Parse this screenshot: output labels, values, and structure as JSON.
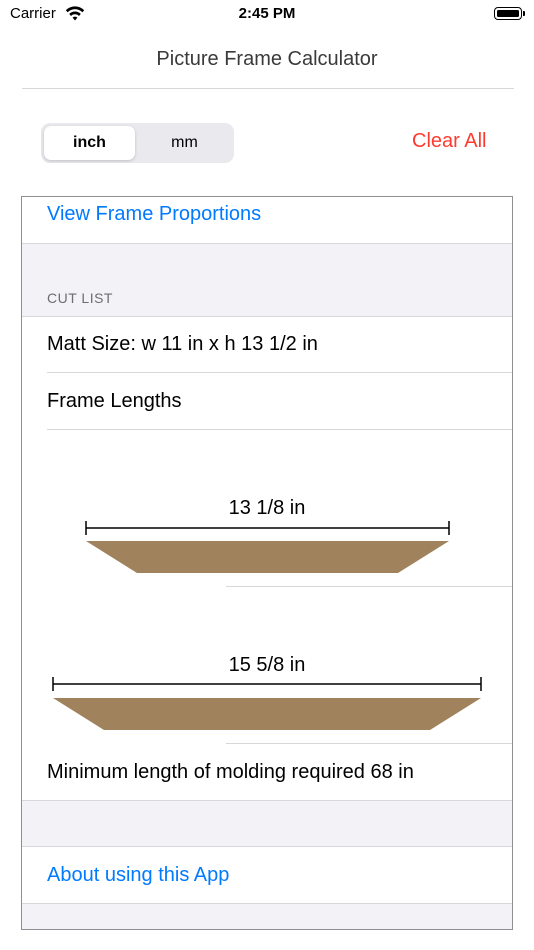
{
  "status_bar": {
    "carrier": "Carrier",
    "time": "2:45 PM"
  },
  "nav": {
    "title": "Picture Frame Calculator"
  },
  "units": {
    "options": [
      "inch",
      "mm"
    ],
    "selected": "inch"
  },
  "actions": {
    "clear_all": "Clear All"
  },
  "table": {
    "view_proportions": "View Frame Proportions",
    "cut_list_header": "CUT LIST",
    "matt_size": "Matt Size: w 11 in x h 13 1/2 in",
    "frame_lengths_label": "Frame Lengths",
    "frame_top_length": "13 1/8 in",
    "frame_side_length": "15 5/8 in",
    "minimum_molding": "Minimum length of molding required  68 in",
    "about": "About using this App"
  },
  "colors": {
    "accent": "#007aff",
    "destructive": "#ff3b30",
    "molding": "#a0825d",
    "grouped_background": "#f2f2f7"
  }
}
